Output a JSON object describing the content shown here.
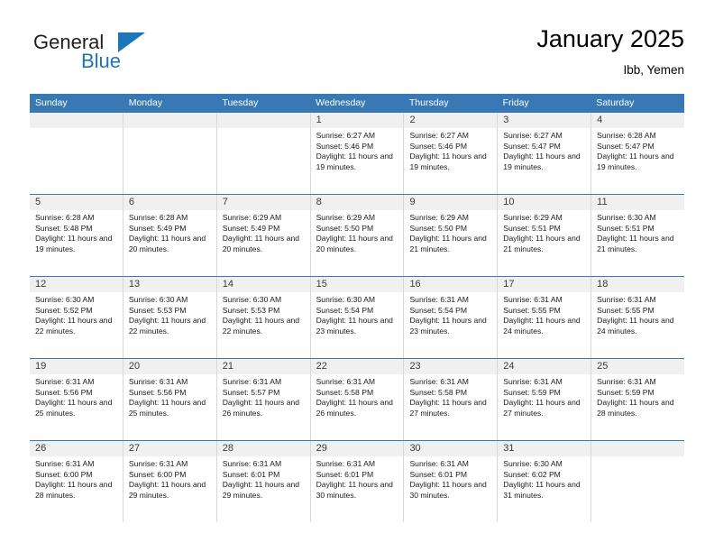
{
  "brand": {
    "name_part1": "General",
    "name_part2": "Blue",
    "logo_icon": "triangle-flag-icon"
  },
  "header": {
    "title": "January 2025",
    "subtitle": "Ibb, Yemen"
  },
  "colors": {
    "header_band": "#3878b4",
    "brand_blue": "#1b75bb",
    "day_number_band": "#f0f0f0",
    "cell_border": "#d8d8d8"
  },
  "weekdays": [
    "Sunday",
    "Monday",
    "Tuesday",
    "Wednesday",
    "Thursday",
    "Friday",
    "Saturday"
  ],
  "labels": {
    "sunrise_prefix": "Sunrise:",
    "sunset_prefix": "Sunset:",
    "daylight_prefix": "Daylight:"
  },
  "weeks": [
    [
      {
        "day": "",
        "sunrise": "",
        "sunset": "",
        "daylight": ""
      },
      {
        "day": "",
        "sunrise": "",
        "sunset": "",
        "daylight": ""
      },
      {
        "day": "",
        "sunrise": "",
        "sunset": "",
        "daylight": ""
      },
      {
        "day": "1",
        "sunrise": "Sunrise: 6:27 AM",
        "sunset": "Sunset: 5:46 PM",
        "daylight": "Daylight: 11 hours and 19 minutes."
      },
      {
        "day": "2",
        "sunrise": "Sunrise: 6:27 AM",
        "sunset": "Sunset: 5:46 PM",
        "daylight": "Daylight: 11 hours and 19 minutes."
      },
      {
        "day": "3",
        "sunrise": "Sunrise: 6:27 AM",
        "sunset": "Sunset: 5:47 PM",
        "daylight": "Daylight: 11 hours and 19 minutes."
      },
      {
        "day": "4",
        "sunrise": "Sunrise: 6:28 AM",
        "sunset": "Sunset: 5:47 PM",
        "daylight": "Daylight: 11 hours and 19 minutes."
      }
    ],
    [
      {
        "day": "5",
        "sunrise": "Sunrise: 6:28 AM",
        "sunset": "Sunset: 5:48 PM",
        "daylight": "Daylight: 11 hours and 19 minutes."
      },
      {
        "day": "6",
        "sunrise": "Sunrise: 6:28 AM",
        "sunset": "Sunset: 5:49 PM",
        "daylight": "Daylight: 11 hours and 20 minutes."
      },
      {
        "day": "7",
        "sunrise": "Sunrise: 6:29 AM",
        "sunset": "Sunset: 5:49 PM",
        "daylight": "Daylight: 11 hours and 20 minutes."
      },
      {
        "day": "8",
        "sunrise": "Sunrise: 6:29 AM",
        "sunset": "Sunset: 5:50 PM",
        "daylight": "Daylight: 11 hours and 20 minutes."
      },
      {
        "day": "9",
        "sunrise": "Sunrise: 6:29 AM",
        "sunset": "Sunset: 5:50 PM",
        "daylight": "Daylight: 11 hours and 21 minutes."
      },
      {
        "day": "10",
        "sunrise": "Sunrise: 6:29 AM",
        "sunset": "Sunset: 5:51 PM",
        "daylight": "Daylight: 11 hours and 21 minutes."
      },
      {
        "day": "11",
        "sunrise": "Sunrise: 6:30 AM",
        "sunset": "Sunset: 5:51 PM",
        "daylight": "Daylight: 11 hours and 21 minutes."
      }
    ],
    [
      {
        "day": "12",
        "sunrise": "Sunrise: 6:30 AM",
        "sunset": "Sunset: 5:52 PM",
        "daylight": "Daylight: 11 hours and 22 minutes."
      },
      {
        "day": "13",
        "sunrise": "Sunrise: 6:30 AM",
        "sunset": "Sunset: 5:53 PM",
        "daylight": "Daylight: 11 hours and 22 minutes."
      },
      {
        "day": "14",
        "sunrise": "Sunrise: 6:30 AM",
        "sunset": "Sunset: 5:53 PM",
        "daylight": "Daylight: 11 hours and 22 minutes."
      },
      {
        "day": "15",
        "sunrise": "Sunrise: 6:30 AM",
        "sunset": "Sunset: 5:54 PM",
        "daylight": "Daylight: 11 hours and 23 minutes."
      },
      {
        "day": "16",
        "sunrise": "Sunrise: 6:31 AM",
        "sunset": "Sunset: 5:54 PM",
        "daylight": "Daylight: 11 hours and 23 minutes."
      },
      {
        "day": "17",
        "sunrise": "Sunrise: 6:31 AM",
        "sunset": "Sunset: 5:55 PM",
        "daylight": "Daylight: 11 hours and 24 minutes."
      },
      {
        "day": "18",
        "sunrise": "Sunrise: 6:31 AM",
        "sunset": "Sunset: 5:55 PM",
        "daylight": "Daylight: 11 hours and 24 minutes."
      }
    ],
    [
      {
        "day": "19",
        "sunrise": "Sunrise: 6:31 AM",
        "sunset": "Sunset: 5:56 PM",
        "daylight": "Daylight: 11 hours and 25 minutes."
      },
      {
        "day": "20",
        "sunrise": "Sunrise: 6:31 AM",
        "sunset": "Sunset: 5:56 PM",
        "daylight": "Daylight: 11 hours and 25 minutes."
      },
      {
        "day": "21",
        "sunrise": "Sunrise: 6:31 AM",
        "sunset": "Sunset: 5:57 PM",
        "daylight": "Daylight: 11 hours and 26 minutes."
      },
      {
        "day": "22",
        "sunrise": "Sunrise: 6:31 AM",
        "sunset": "Sunset: 5:58 PM",
        "daylight": "Daylight: 11 hours and 26 minutes."
      },
      {
        "day": "23",
        "sunrise": "Sunrise: 6:31 AM",
        "sunset": "Sunset: 5:58 PM",
        "daylight": "Daylight: 11 hours and 27 minutes."
      },
      {
        "day": "24",
        "sunrise": "Sunrise: 6:31 AM",
        "sunset": "Sunset: 5:59 PM",
        "daylight": "Daylight: 11 hours and 27 minutes."
      },
      {
        "day": "25",
        "sunrise": "Sunrise: 6:31 AM",
        "sunset": "Sunset: 5:59 PM",
        "daylight": "Daylight: 11 hours and 28 minutes."
      }
    ],
    [
      {
        "day": "26",
        "sunrise": "Sunrise: 6:31 AM",
        "sunset": "Sunset: 6:00 PM",
        "daylight": "Daylight: 11 hours and 28 minutes."
      },
      {
        "day": "27",
        "sunrise": "Sunrise: 6:31 AM",
        "sunset": "Sunset: 6:00 PM",
        "daylight": "Daylight: 11 hours and 29 minutes."
      },
      {
        "day": "28",
        "sunrise": "Sunrise: 6:31 AM",
        "sunset": "Sunset: 6:01 PM",
        "daylight": "Daylight: 11 hours and 29 minutes."
      },
      {
        "day": "29",
        "sunrise": "Sunrise: 6:31 AM",
        "sunset": "Sunset: 6:01 PM",
        "daylight": "Daylight: 11 hours and 30 minutes."
      },
      {
        "day": "30",
        "sunrise": "Sunrise: 6:31 AM",
        "sunset": "Sunset: 6:01 PM",
        "daylight": "Daylight: 11 hours and 30 minutes."
      },
      {
        "day": "31",
        "sunrise": "Sunrise: 6:30 AM",
        "sunset": "Sunset: 6:02 PM",
        "daylight": "Daylight: 11 hours and 31 minutes."
      },
      {
        "day": "",
        "sunrise": "",
        "sunset": "",
        "daylight": ""
      }
    ]
  ]
}
